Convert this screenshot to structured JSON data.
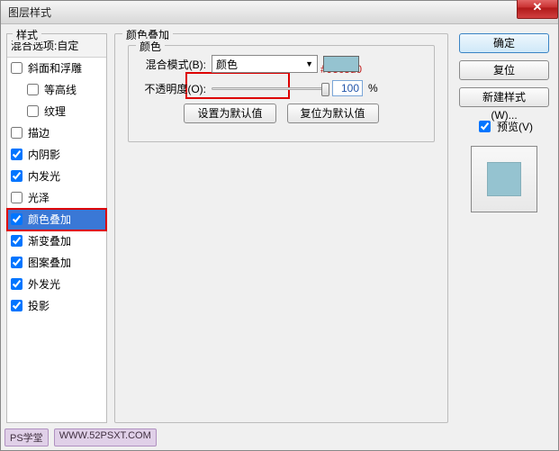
{
  "window": {
    "title": "图层样式"
  },
  "styles_panel": {
    "label": "样式",
    "blend_options": "混合选项:自定",
    "items": [
      {
        "label": "斜面和浮雕",
        "checked": false,
        "indent": false
      },
      {
        "label": "等高线",
        "checked": false,
        "indent": true
      },
      {
        "label": "纹理",
        "checked": false,
        "indent": true
      },
      {
        "label": "描边",
        "checked": false,
        "indent": false
      },
      {
        "label": "内阴影",
        "checked": true,
        "indent": false
      },
      {
        "label": "内发光",
        "checked": true,
        "indent": false
      },
      {
        "label": "光泽",
        "checked": false,
        "indent": false
      },
      {
        "label": "颜色叠加",
        "checked": true,
        "indent": false,
        "selected": true
      },
      {
        "label": "渐变叠加",
        "checked": true,
        "indent": false
      },
      {
        "label": "图案叠加",
        "checked": true,
        "indent": false
      },
      {
        "label": "外发光",
        "checked": true,
        "indent": false
      },
      {
        "label": "投影",
        "checked": true,
        "indent": false
      }
    ]
  },
  "main": {
    "title": "颜色叠加",
    "group": "颜色",
    "blend_mode_label": "混合模式(B):",
    "blend_mode_value": "颜色",
    "swatch_hex": "#95c3d0",
    "opacity_label": "不透明度(O):",
    "opacity_value": "100",
    "opacity_unit": "%",
    "btn_default": "设置为默认值",
    "btn_reset": "复位为默认值"
  },
  "right": {
    "ok": "确定",
    "cancel": "复位",
    "new_style": "新建样式(W)...",
    "preview_label": "预览(V)",
    "preview_checked": true
  },
  "footer": {
    "tag1": "PS学堂",
    "tag2": "WWW.52PSXT.COM"
  },
  "colors": {
    "accent": "#95c3d0",
    "annotation": "#d00000"
  }
}
